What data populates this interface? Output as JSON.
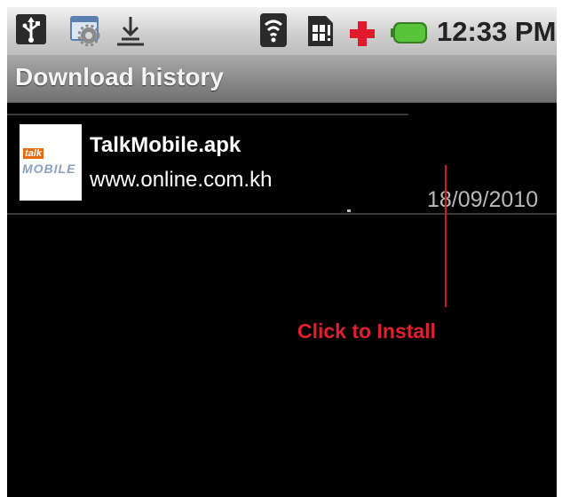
{
  "status_bar": {
    "time": "12:33 PM",
    "icons": [
      "usb-icon",
      "settings-notification-icon",
      "download-notification-icon",
      "wifi-icon",
      "sim-card-icon",
      "plus-icon",
      "battery-icon"
    ],
    "colors": {
      "battery": "#58c43a",
      "plus": "#e0192d"
    }
  },
  "title_bar": {
    "title": "Download history"
  },
  "downloads": [
    {
      "thumbnail": {
        "logo_line1": "talk",
        "logo_line2": "MOBILE"
      },
      "file_name": "TalkMobile.apk",
      "source": "www.online.com.kh",
      "date": "18/09/2010"
    }
  ],
  "annotation": {
    "text": "Click to Install",
    "color": "#e0202e"
  }
}
